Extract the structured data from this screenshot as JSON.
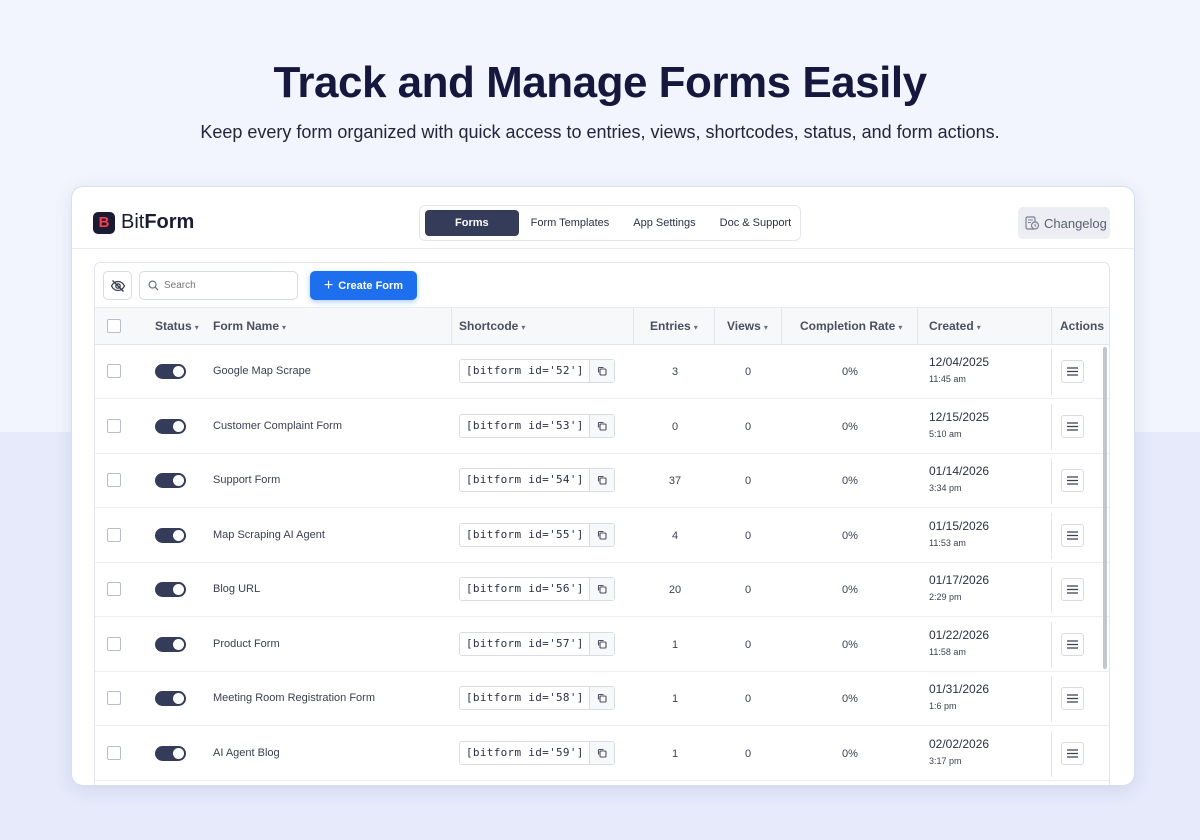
{
  "hero": {
    "title": "Track and Manage Forms Easily",
    "subtitle": "Keep every form organized with quick access to entries, views, shortcodes, status, and form actions."
  },
  "app": {
    "logo_bit": "Bit",
    "logo_form": "Form",
    "logo_letter": "B",
    "nav": [
      "Forms",
      "Form Templates",
      "App Settings",
      "Doc & Support"
    ],
    "active_nav": "Forms",
    "changelog": "Changelog"
  },
  "toolbar": {
    "search_placeholder": "Search",
    "create_label": "Create Form"
  },
  "columns": {
    "status": "Status",
    "form_name": "Form Name",
    "shortcode": "Shortcode",
    "entries": "Entries",
    "views": "Views",
    "completion_rate": "Completion Rate",
    "created": "Created",
    "actions": "Actions",
    "sort_caret": "▾"
  },
  "rows": [
    {
      "name": "Google Map Scrape",
      "shortcode": "[bitform id='52']",
      "entries": "3",
      "views": "0",
      "rate": "0%",
      "date": "12/04/2025",
      "time": "11:45 am",
      "enabled": true
    },
    {
      "name": "Customer Complaint Form",
      "shortcode": "[bitform id='53']",
      "entries": "0",
      "views": "0",
      "rate": "0%",
      "date": "12/15/2025",
      "time": "5:10 am",
      "enabled": true
    },
    {
      "name": "Support Form",
      "shortcode": "[bitform id='54']",
      "entries": "37",
      "views": "0",
      "rate": "0%",
      "date": "01/14/2026",
      "time": "3:34 pm",
      "enabled": true
    },
    {
      "name": "Map Scraping AI Agent",
      "shortcode": "[bitform id='55']",
      "entries": "4",
      "views": "0",
      "rate": "0%",
      "date": "01/15/2026",
      "time": "11:53 am",
      "enabled": true
    },
    {
      "name": "Blog URL",
      "shortcode": "[bitform id='56']",
      "entries": "20",
      "views": "0",
      "rate": "0%",
      "date": "01/17/2026",
      "time": "2:29 pm",
      "enabled": true
    },
    {
      "name": "Product Form",
      "shortcode": "[bitform id='57']",
      "entries": "1",
      "views": "0",
      "rate": "0%",
      "date": "01/22/2026",
      "time": "11:58 am",
      "enabled": true
    },
    {
      "name": "Meeting Room Registration Form",
      "shortcode": "[bitform id='58']",
      "entries": "1",
      "views": "0",
      "rate": "0%",
      "date": "01/31/2026",
      "time": "1:6 pm",
      "enabled": true
    },
    {
      "name": "AI Agent Blog",
      "shortcode": "[bitform id='59']",
      "entries": "1",
      "views": "0",
      "rate": "0%",
      "date": "02/02/2026",
      "time": "3:17 pm",
      "enabled": true
    }
  ],
  "colors": {
    "primary": "#1d6fed",
    "nav_active": "#353c5a",
    "toggle_on": "#353c5a",
    "logo_accent": "#ff3b4a"
  }
}
